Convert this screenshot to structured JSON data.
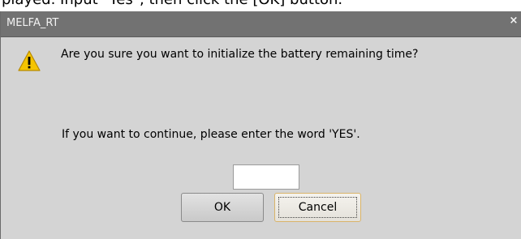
{
  "caption": "played. Input \"Yes\", then click the [OK] button.",
  "dialog": {
    "title": "MELFA_RT",
    "close_label": "×",
    "question": "Are you sure you want to initialize the battery remaining time?",
    "instruction": "If you want to continue, please enter the word 'YES'.",
    "input_value": "",
    "ok_label": "OK",
    "cancel_label": "Cancel",
    "icon": "warning-icon"
  },
  "colors": {
    "titlebar": "#727272",
    "body": "#d4d4d4",
    "warning_fill": "#f5c400",
    "focus_border": "#d9b46a"
  }
}
